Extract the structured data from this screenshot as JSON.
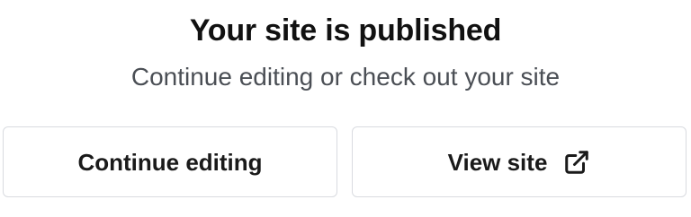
{
  "dialog": {
    "title": "Your site is published",
    "subtitle": "Continue editing or check out your site"
  },
  "actions": {
    "continue_label": "Continue editing",
    "view_label": "View site",
    "view_icon": "external-link-icon"
  },
  "colors": {
    "title": "#111111",
    "subtitle": "#4b4f55",
    "button_border": "#d9dbe0",
    "button_text": "#1a1a1a"
  }
}
